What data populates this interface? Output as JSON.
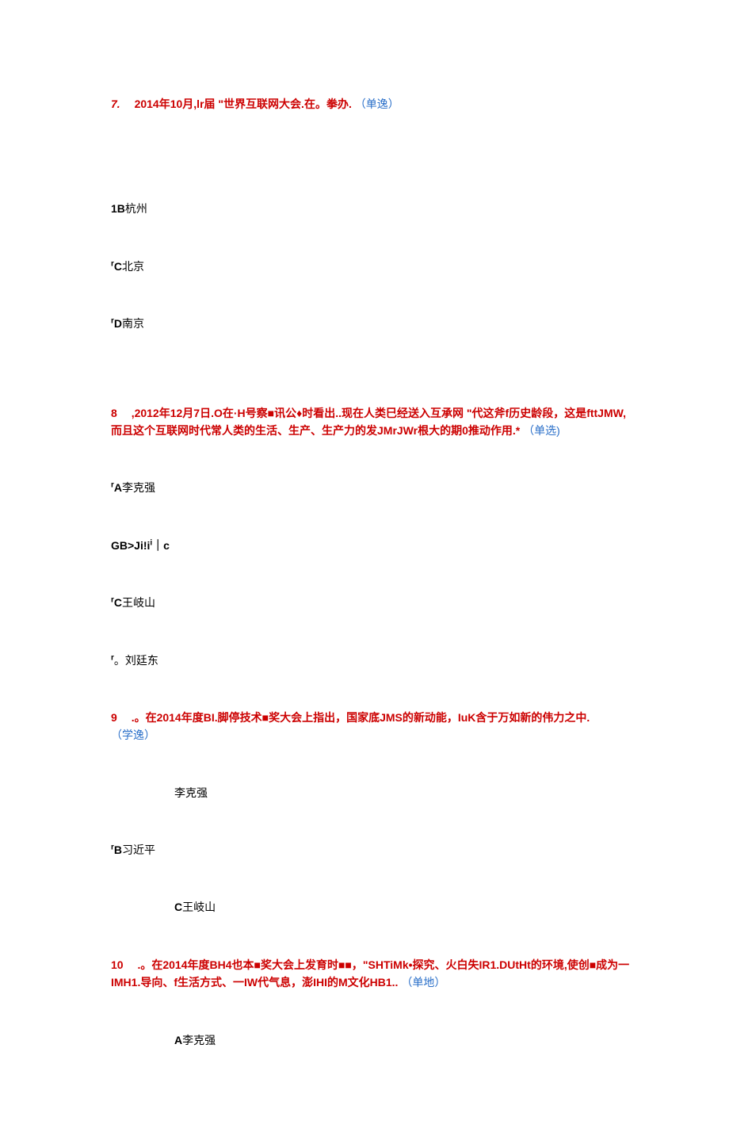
{
  "q7": {
    "num": "7.",
    "stem_a": "2014年10月,lr届 \"世界互联网大会.在。拳办.",
    "type": "（单逸）",
    "opts": {
      "b": {
        "label": "1B",
        "text": "杭州"
      },
      "c": {
        "prefix": "r",
        "label": "C",
        "text": "北京"
      },
      "d": {
        "prefix": "r",
        "label": "D",
        "text": "南京"
      }
    }
  },
  "q8": {
    "num": "8",
    "stem_a": ",2012年12月7日.O在·H号察■讯公♦时看出..现在人类巳经送入互承网 \"代这斧f历史龄段，这是fttJMW,而且这个互联网时代常人类的生活、生产、生产力的发JMrJWr根大的期0推动作用.*",
    "type": "（单选)",
    "opts": {
      "a": {
        "prefix": "r",
        "label": "A",
        "text": "李克强"
      },
      "b": {
        "label": "GB>Ji!i",
        "sup": "i",
        "rest": "｜c"
      },
      "c": {
        "prefix": "r",
        "label": "C",
        "text": "王岐山"
      },
      "d": {
        "prefix": "r",
        "text": "。刘廷东"
      }
    }
  },
  "q9": {
    "num": "9",
    "stem_a": ".。在2014年度BI.脚停技术■奖大会上指出，国家底JMS的新动能，IuK含于万如新的伟力之中.",
    "type": "（学逸）",
    "opts": {
      "a": {
        "text": "李克强"
      },
      "b": {
        "prefix": "r",
        "label": "B",
        "text": "习近平"
      },
      "c": {
        "label": "C",
        "text": "王岐山"
      }
    }
  },
  "q10": {
    "num": "10",
    "stem_a": ".。在2014年度BH4也本■奖大会上发育时■■，\"SHTiMk•探究、火白失IR1.DUtHt的环境,使创■成为一IMH1.导向、f生活方式、一IW代气息，澎IHI的M文化HB1..",
    "type": "（单地）",
    "opts": {
      "a": {
        "label": "A",
        "text": "李克强"
      }
    }
  }
}
